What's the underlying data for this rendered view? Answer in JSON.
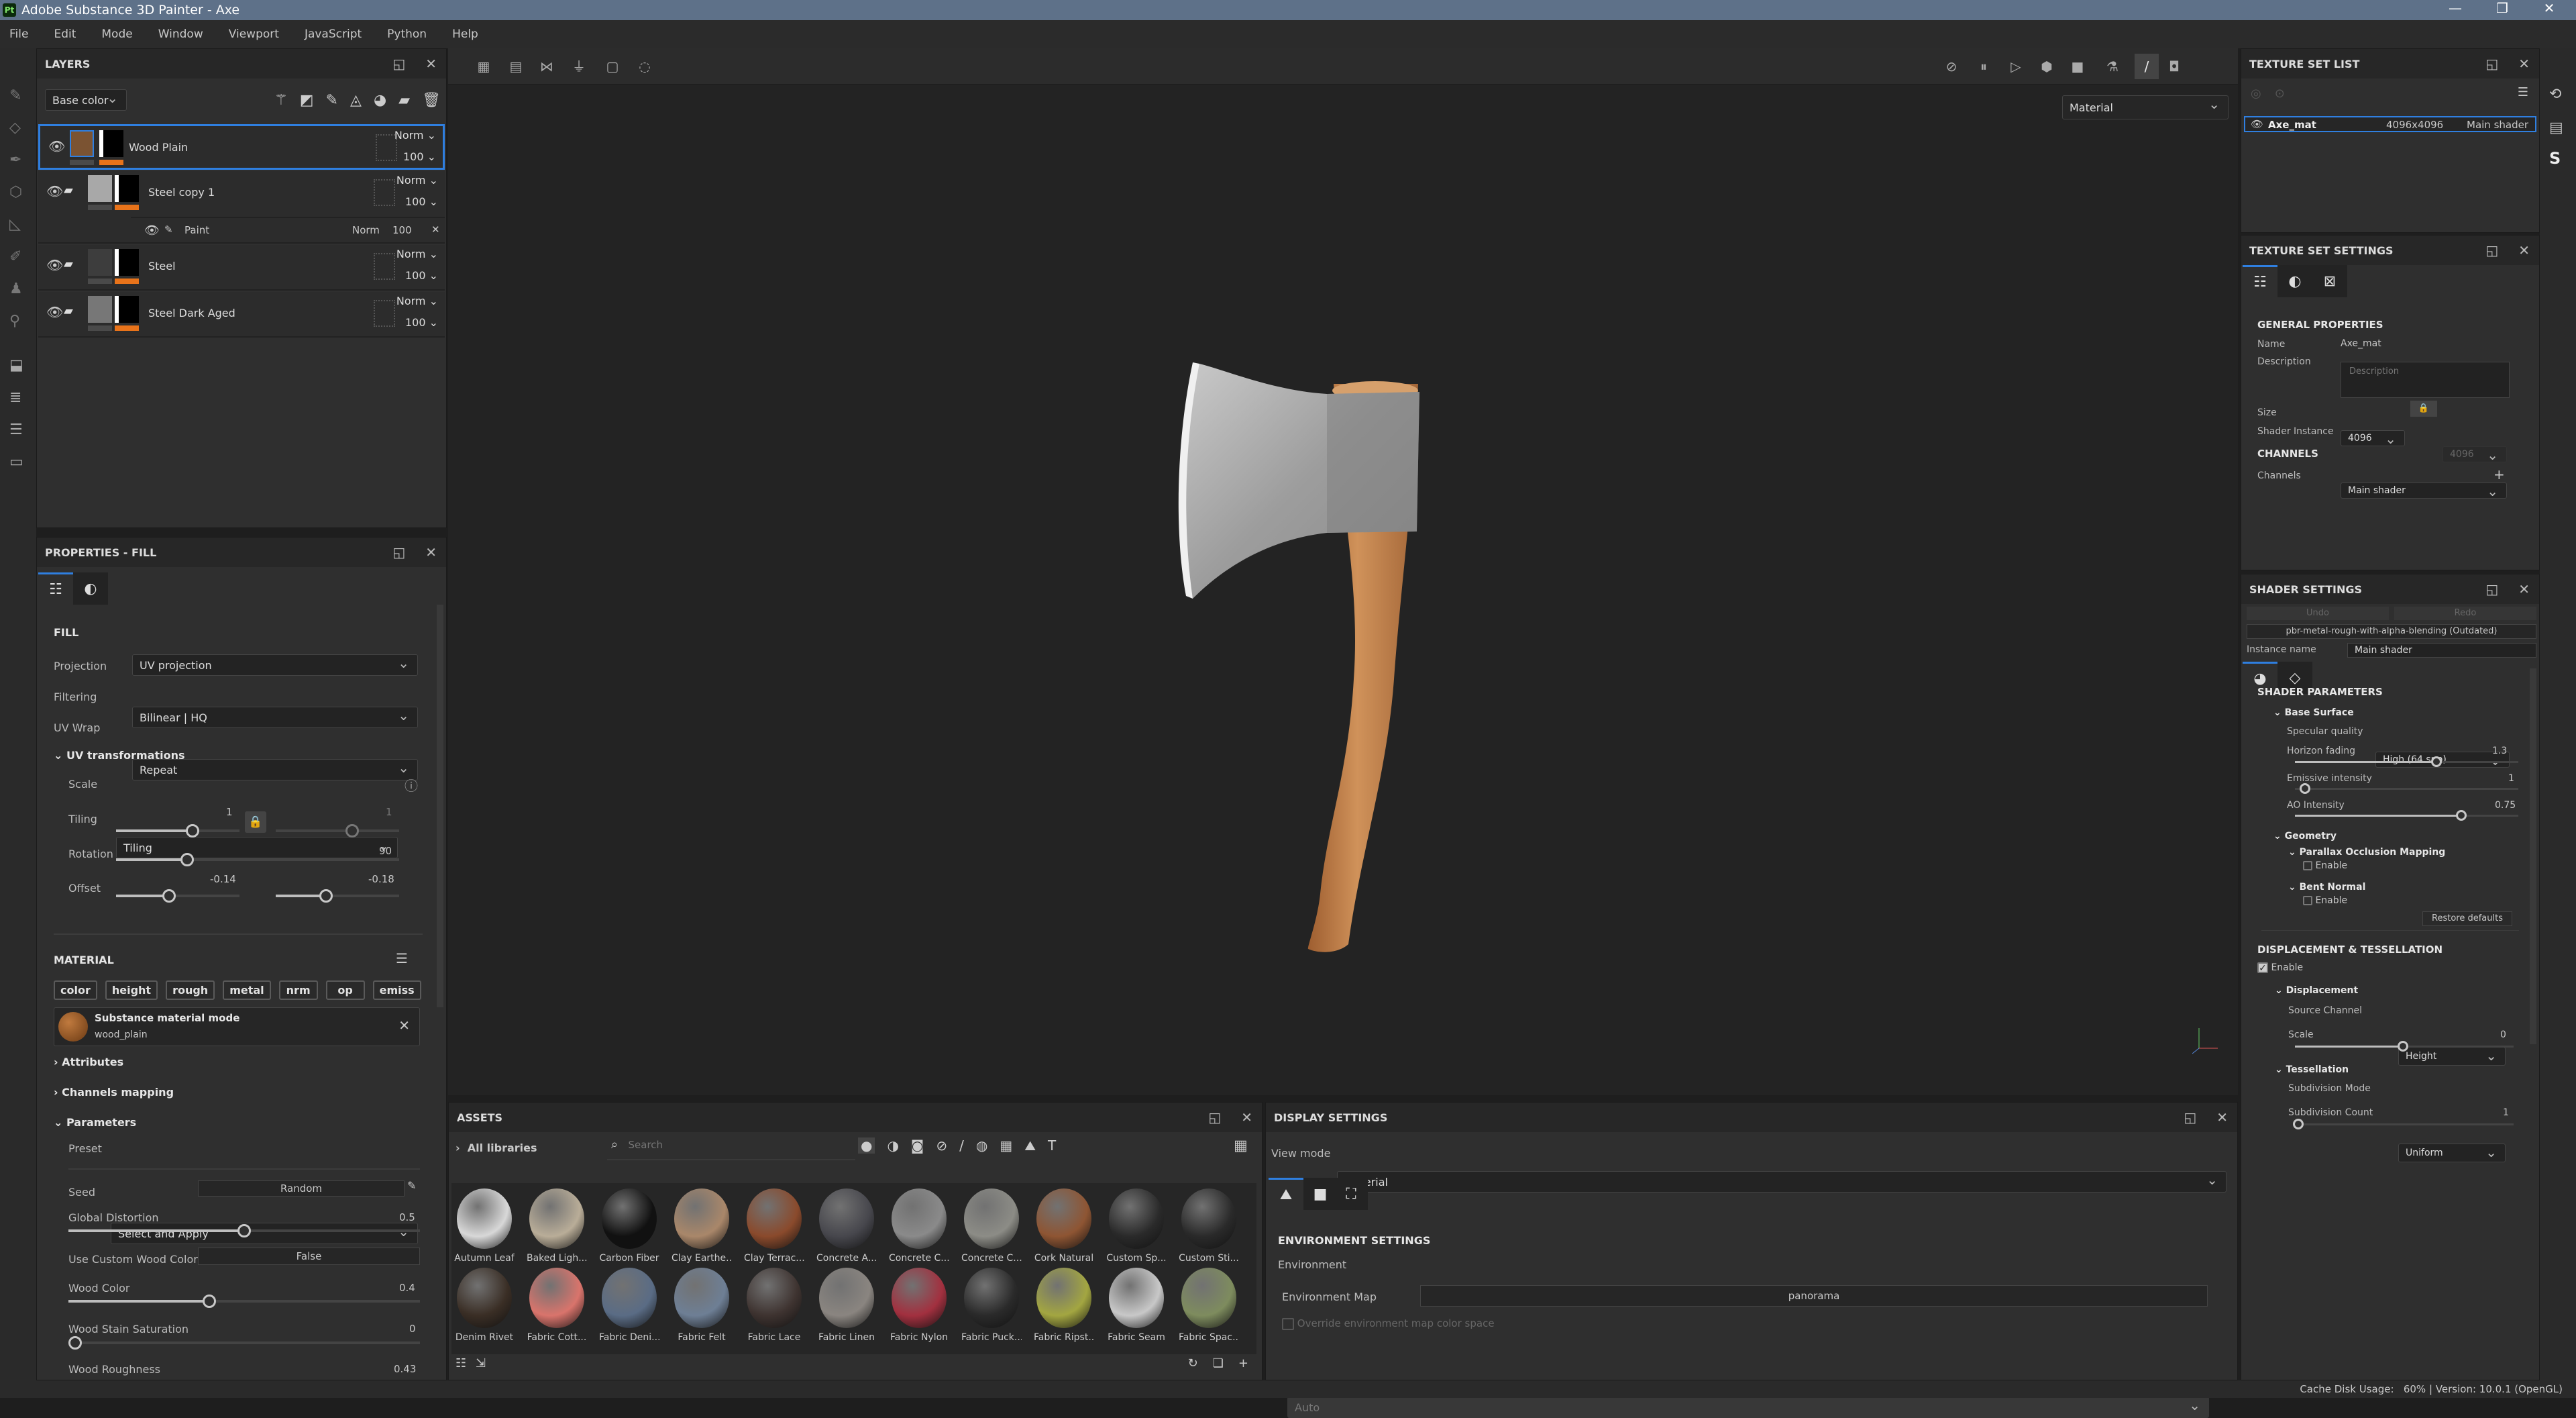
{
  "app": {
    "title": "Adobe Substance 3D Painter - Axe",
    "logo": "Pt",
    "window_controls": [
      "minimize",
      "restore",
      "close"
    ]
  },
  "menu": [
    "File",
    "Edit",
    "Mode",
    "Window",
    "Viewport",
    "JavaScript",
    "Python",
    "Help"
  ],
  "left_tools": [
    "paint-brush-icon",
    "eraser-icon",
    "projection-icon",
    "geometry-mask-icon",
    "polygon-fill-icon",
    "smudge-icon",
    "clone-stamp-icon",
    "color-picker-icon"
  ],
  "left_tools_lower": [
    "assets-icon",
    "layers-icon",
    "history-icon",
    "log-icon"
  ],
  "layers": {
    "title": "LAYERS",
    "channel": "Base color",
    "items": [
      {
        "name": "Wood Plain",
        "blend": "Norm",
        "opacity": "100",
        "selected": true,
        "thumb": "#7b5332",
        "folder": false
      },
      {
        "name": "Steel copy 1",
        "blend": "Norm",
        "opacity": "100",
        "selected": false,
        "thumb": "#a8a8a8",
        "folder": true
      },
      {
        "name": "Steel",
        "blend": "Norm",
        "opacity": "100",
        "selected": false,
        "thumb": "#3d3d3d",
        "folder": true
      },
      {
        "name": "Steel Dark Aged",
        "blend": "Norm",
        "opacity": "100",
        "selected": false,
        "thumb": "#777",
        "folder": true
      }
    ],
    "sublayer": {
      "name": "Paint",
      "blend": "Norm",
      "opacity": "100"
    }
  },
  "properties": {
    "title": "PROPERTIES - FILL",
    "fill_heading": "FILL",
    "projection_label": "Projection",
    "projection": "UV projection",
    "filtering_label": "Filtering",
    "filtering": "Bilinear | HQ",
    "uvwrap_label": "UV Wrap",
    "uvwrap": "Repeat",
    "uvt_heading": "UV transformations",
    "scale_label": "Scale",
    "scale": "Tiling",
    "tiling_label": "Tiling",
    "tiling_u": "1",
    "tiling_v": "1",
    "rotation_label": "Rotation",
    "rotation": "90",
    "offset_label": "Offset",
    "offset_u": "-0.14",
    "offset_v": "-0.18",
    "material_heading": "MATERIAL",
    "channels": [
      "color",
      "height",
      "rough",
      "metal",
      "nrm",
      "op",
      "emiss"
    ],
    "mode_title": "Substance material mode",
    "mode_material": "wood_plain",
    "attributes": "Attributes",
    "channels_mapping": "Channels mapping",
    "parameters": "Parameters",
    "preset_label": "Preset",
    "preset": "Select and Apply",
    "seed_label": "Seed",
    "seed": "Random",
    "global_distortion_label": "Global Distortion",
    "global_distortion": "0.5",
    "custom_color_label": "Use Custom Wood Color",
    "custom_color": "False",
    "wood_color_label": "Wood Color",
    "wood_color": "0.4",
    "stain_label": "Wood Stain Saturation",
    "stain": "0",
    "roughness_label": "Wood Roughness",
    "roughness": "0.43"
  },
  "viewport": {
    "view_mode": "Material",
    "accent": "#2f7fe0"
  },
  "assets": {
    "title": "ASSETS",
    "library": "All libraries",
    "search_placeholder": "Search",
    "items": [
      {
        "name": "Autumn Leaf",
        "color": "#d8d8d8"
      },
      {
        "name": "Baked Ligh...",
        "color": "#b9ad98"
      },
      {
        "name": "Carbon Fiber",
        "color": "#111"
      },
      {
        "name": "Clay Earthe...",
        "color": "#a9876a"
      },
      {
        "name": "Clay Terrac...",
        "color": "#8a4a2c"
      },
      {
        "name": "Concrete A...",
        "color": "#47474d"
      },
      {
        "name": "Concrete C...",
        "color": "#8a8a8a"
      },
      {
        "name": "Concrete C...",
        "color": "#8c8c86"
      },
      {
        "name": "Cork Natural",
        "color": "#8e5533"
      },
      {
        "name": "Custom Sp...",
        "color": "#2a2a2a"
      },
      {
        "name": "Custom Sti...",
        "color": "#2a2a2a"
      },
      {
        "name": "Denim Rivet",
        "color": "#3a2e25"
      },
      {
        "name": "Fabric Cott...",
        "color": "#d9746c"
      },
      {
        "name": "Fabric Deni...",
        "color": "#5a6c85"
      },
      {
        "name": "Fabric Felt",
        "color": "#6e7f95"
      },
      {
        "name": "Fabric Lace",
        "color": "#3e3330"
      },
      {
        "name": "Fabric Linen",
        "color": "#8a8580"
      },
      {
        "name": "Fabric Nylon",
        "color": "#a2303f"
      },
      {
        "name": "Fabric Puck...",
        "color": "#2a2a2a"
      },
      {
        "name": "Fabric Ripst...",
        "color": "#a3a641"
      },
      {
        "name": "Fabric Seam",
        "color": "#c8c8c8"
      },
      {
        "name": "Fabric Spac...",
        "color": "#7e8c5e"
      }
    ]
  },
  "display": {
    "title": "DISPLAY SETTINGS",
    "view_mode_label": "View mode",
    "view_mode": "Material",
    "env_heading": "ENVIRONMENT SETTINGS",
    "env_label": "Environment",
    "env_map_label": "Environment Map",
    "env_map": "panorama",
    "override_label": "Override environment map color space",
    "color_space": "Auto"
  },
  "texture_set_list": {
    "title": "TEXTURE SET LIST",
    "name": "Axe_mat",
    "size": "4096x4096",
    "shader": "Main shader"
  },
  "texture_set_settings": {
    "title": "TEXTURE SET SETTINGS",
    "general": "GENERAL PROPERTIES",
    "name_label": "Name",
    "name": "Axe_mat",
    "desc_label": "Description",
    "desc_placeholder": "Description",
    "size_label": "Size",
    "size_w": "4096",
    "size_h": "4096",
    "shader_label": "Shader Instance",
    "shader": "Main shader",
    "channels_heading": "CHANNELS",
    "channels_label": "Channels"
  },
  "shader_settings": {
    "title": "SHADER SETTINGS",
    "undo": "Undo",
    "redo": "Redo",
    "shader_file": "pbr-metal-rough-with-alpha-blending (Outdated)",
    "instance_label": "Instance name",
    "instance": "Main shader",
    "params_heading": "SHADER PARAMETERS",
    "base_surface": "Base Surface",
    "spec_label": "Specular quality",
    "spec": "High (64 spp)",
    "horizon_label": "Horizon fading",
    "horizon": "1.3",
    "emissive_label": "Emissive intensity",
    "emissive": "1",
    "ao_label": "AO Intensity",
    "ao": "0.75",
    "geometry": "Geometry",
    "pom": "Parallax Occlusion Mapping",
    "pom_enable": "Enable",
    "bent": "Bent Normal",
    "bent_enable": "Enable",
    "restore": "Restore defaults",
    "disp_heading": "DISPLACEMENT & TESSELLATION",
    "disp_enable": "Enable",
    "displacement": "Displacement",
    "source_label": "Source Channel",
    "source": "Height",
    "scale_label": "Scale",
    "scale": "0",
    "tessellation": "Tessellation",
    "subdiv_mode_label": "Subdivision Mode",
    "subdiv_mode": "Uniform",
    "subdiv_count_label": "Subdivision Count",
    "subdiv_count": "1"
  },
  "status": {
    "cache_label": "Cache Disk Usage:",
    "cache": "60%",
    "version": "| Version: 10.0.1 (OpenGL)"
  }
}
